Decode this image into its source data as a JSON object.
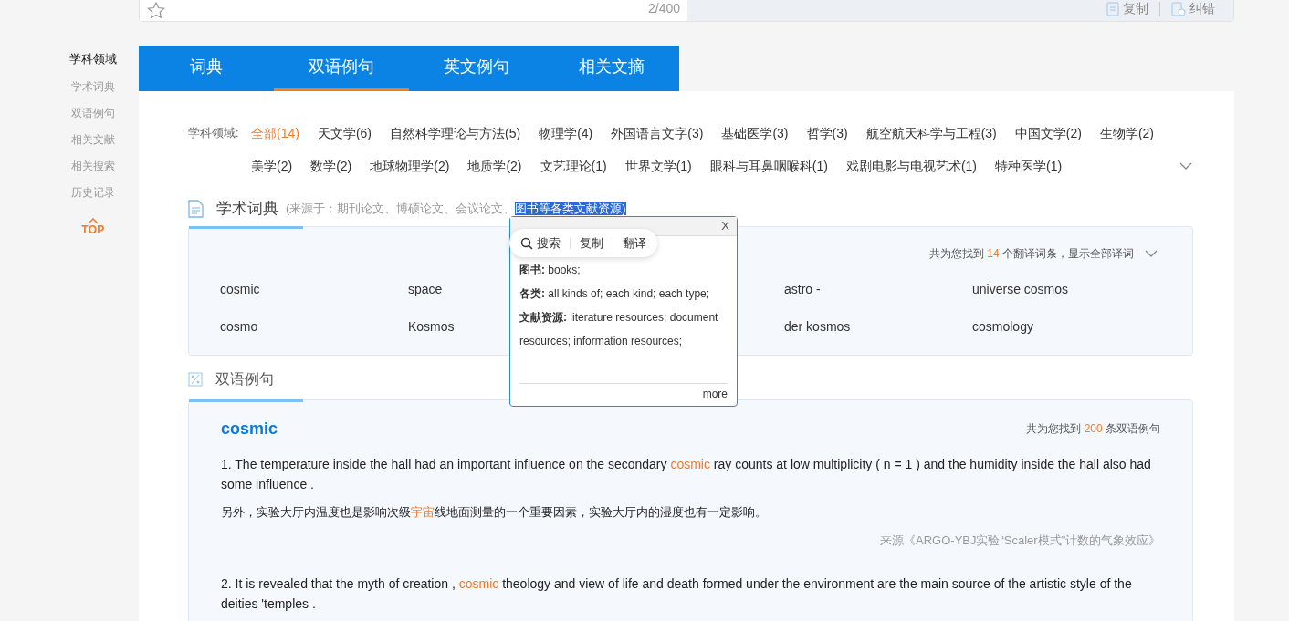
{
  "top_bar": {
    "counter": "2/400",
    "actions": [
      {
        "label": "复制",
        "kind": "copy"
      },
      {
        "label": "纠错",
        "kind": "report"
      }
    ]
  },
  "sidebar": {
    "items": [
      {
        "label": "学科领域",
        "selected": true
      },
      {
        "label": "学术词典",
        "selected": false
      },
      {
        "label": "双语例句",
        "selected": false
      },
      {
        "label": "相关文献",
        "selected": false
      },
      {
        "label": "相关搜索",
        "selected": false
      },
      {
        "label": "历史记录",
        "selected": false
      }
    ],
    "top_label": "TOP"
  },
  "tabs": [
    {
      "label": "词典",
      "selected": false
    },
    {
      "label": "双语例句",
      "selected": true
    },
    {
      "label": "英文例句",
      "selected": false
    },
    {
      "label": "相关文摘",
      "selected": false
    }
  ],
  "filters": {
    "label": "学科领域:",
    "items": [
      {
        "label": "全部(14)",
        "selected": true
      },
      {
        "label": "天文学(6)",
        "selected": false
      },
      {
        "label": "自然科学理论与方法(5)",
        "selected": false
      },
      {
        "label": "物理学(4)",
        "selected": false
      },
      {
        "label": "外国语言文字(3)",
        "selected": false
      },
      {
        "label": "基础医学(3)",
        "selected": false
      },
      {
        "label": "哲学(3)",
        "selected": false
      },
      {
        "label": "航空航天科学与工程(3)",
        "selected": false
      },
      {
        "label": "中国文学(2)",
        "selected": false
      },
      {
        "label": "生物学(2)",
        "selected": false
      },
      {
        "label": "美学(2)",
        "selected": false
      },
      {
        "label": "数学(2)",
        "selected": false
      },
      {
        "label": "地球物理学(2)",
        "selected": false
      },
      {
        "label": "地质学(2)",
        "selected": false
      },
      {
        "label": "文艺理论(1)",
        "selected": false
      },
      {
        "label": "世界文学(1)",
        "selected": false
      },
      {
        "label": "眼科与耳鼻咽喉科(1)",
        "selected": false
      },
      {
        "label": "戏剧电影与电视艺术(1)",
        "selected": false
      },
      {
        "label": "特种医学(1)",
        "selected": false
      }
    ]
  },
  "dictionary": {
    "title": "学术词典",
    "source": "(来源于：期刊论文、博硕论文、会议论文、",
    "source_selected": "图书等各类文献资源)",
    "summary_before": "共为您找到 ",
    "summary_count": "14",
    "summary_after": " 个翻译词条，显示全部译词",
    "terms": [
      {
        "column_1": "cosmic",
        "column_2": "space",
        "column_4": "astro -",
        "column_5": "universe cosmos"
      },
      {
        "column_1": "cosmo",
        "column_2": "Kosmos",
        "column_4": "der kosmos",
        "column_5": "cosmology"
      }
    ]
  },
  "popup": {
    "toolbar": [
      "搜索",
      "复制",
      "翻译"
    ],
    "close": "X",
    "entries": [
      {
        "term": "图书:",
        "meaning": " books;"
      },
      {
        "term": "各类:",
        "meaning": " all kinds of; each kind; each type;"
      },
      {
        "term": "文献资源:",
        "meaning": " literature resources; document resources; information resources;"
      }
    ],
    "more": "more"
  },
  "examples": {
    "title": "双语例句",
    "word": "cosmic",
    "summary_before": "共为您找到 ",
    "summary_count": "200",
    "summary_after": " 条双语例句",
    "items": [
      {
        "english": {
          "before": "1. The temperature inside the hall had an important influence on the secondary ",
          "keyword": "cosmic",
          "after": " ray counts at low multiplicity ( n = 1 ) and the humidity inside the hall also had some influence ."
        },
        "chinese": {
          "before": "另外，实验大厅内温度也是影响次级",
          "keyword": "宇宙",
          "after": "线地面测量的一个重要因素，实验大厅内的湿度也有一定影响。"
        },
        "source": "来源《ARGO-YBJ实验“Scaler模式”计数的气象效应》"
      },
      {
        "english": {
          "before": "2. It is revealed that the myth of creation , ",
          "keyword": "cosmic",
          "after": " theology and view of life and death formed under the environment are the main source of the artistic style of the deities 'temples ."
        }
      }
    ]
  }
}
